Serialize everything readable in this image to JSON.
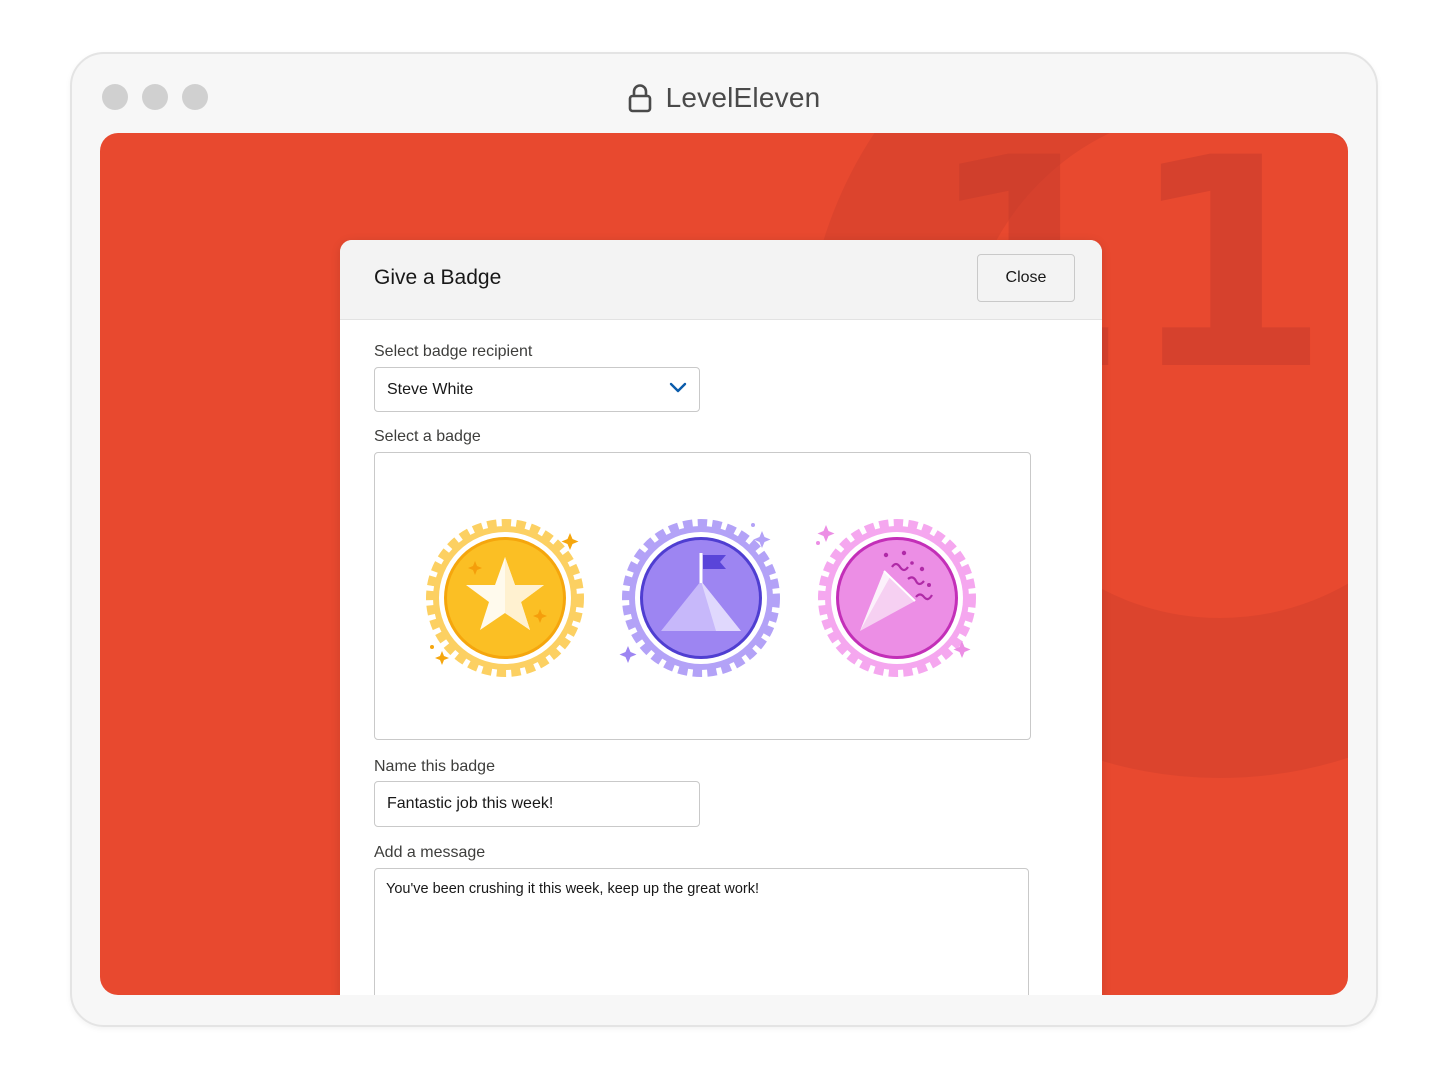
{
  "browser": {
    "title": "LevelEleven",
    "icon": "lock-icon"
  },
  "background": {
    "color": "#e8492f",
    "watermark": "11"
  },
  "modal": {
    "title": "Give a Badge",
    "close_label": "Close",
    "recipient": {
      "label": "Select badge recipient",
      "value": "Steve White"
    },
    "badge_picker": {
      "label": "Select a badge",
      "badges": [
        {
          "name": "star-badge",
          "color": "#fbbf24"
        },
        {
          "name": "mountain-flag-badge",
          "color": "#9d85f2"
        },
        {
          "name": "party-popper-badge",
          "color": "#ec8ee5"
        }
      ]
    },
    "badge_name": {
      "label": "Name this badge",
      "value": "Fantastic job this week!"
    },
    "message": {
      "label": "Add a message",
      "value": "You've been crushing it this week, keep up the great work!"
    }
  }
}
